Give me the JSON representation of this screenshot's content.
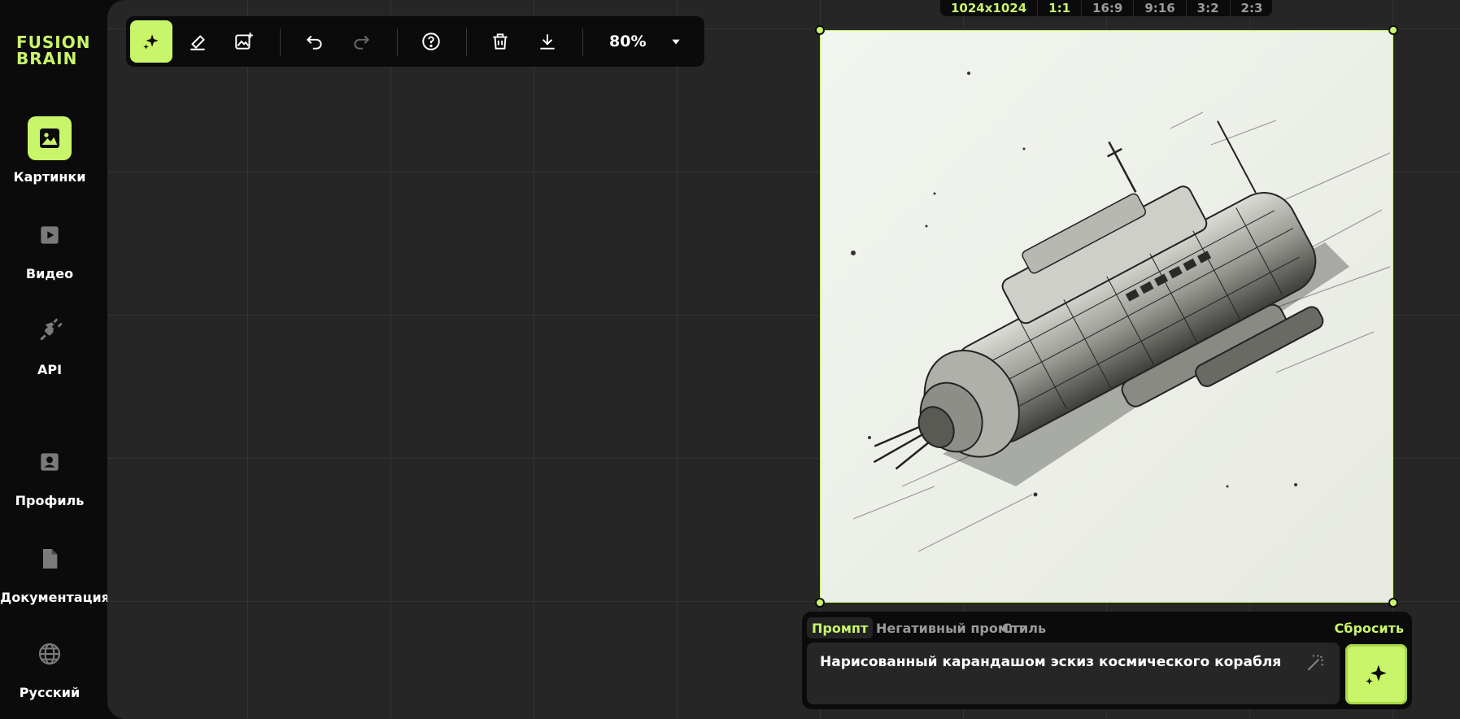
{
  "brand": {
    "line1": "FUSION",
    "line2": "BRAIN",
    "accent": "#c8f56a"
  },
  "sidebar": {
    "items": [
      {
        "label": "Картинки",
        "icon": "image-icon",
        "active": true
      },
      {
        "label": "Видео",
        "icon": "play-icon",
        "active": false
      },
      {
        "label": "API",
        "icon": "plug-icon",
        "active": false
      },
      {
        "label": "Профиль",
        "icon": "profile-icon",
        "active": false
      },
      {
        "label": "Документация",
        "icon": "document-icon",
        "active": false
      },
      {
        "label": "Русский",
        "icon": "globe-icon",
        "active": false
      }
    ]
  },
  "toolbar": {
    "tools": [
      "sparkle-icon",
      "eraser-icon",
      "image-add-icon",
      "undo-icon",
      "redo-icon",
      "help-icon",
      "trash-icon",
      "download-icon"
    ],
    "active_tool": "sparkle-icon",
    "zoom": "80%"
  },
  "ratios": {
    "resolution": "1024x1024",
    "options": [
      "1:1",
      "16:9",
      "9:16",
      "3:2",
      "2:3"
    ],
    "selected": "1:1"
  },
  "prompt_panel": {
    "tabs": [
      "Промпт",
      "Негативный промпт",
      "Стиль"
    ],
    "active_tab": "Промпт",
    "reset_label": "Сбросить",
    "prompt_text": "Нарисованный карандашом эскиз космического корабля"
  }
}
